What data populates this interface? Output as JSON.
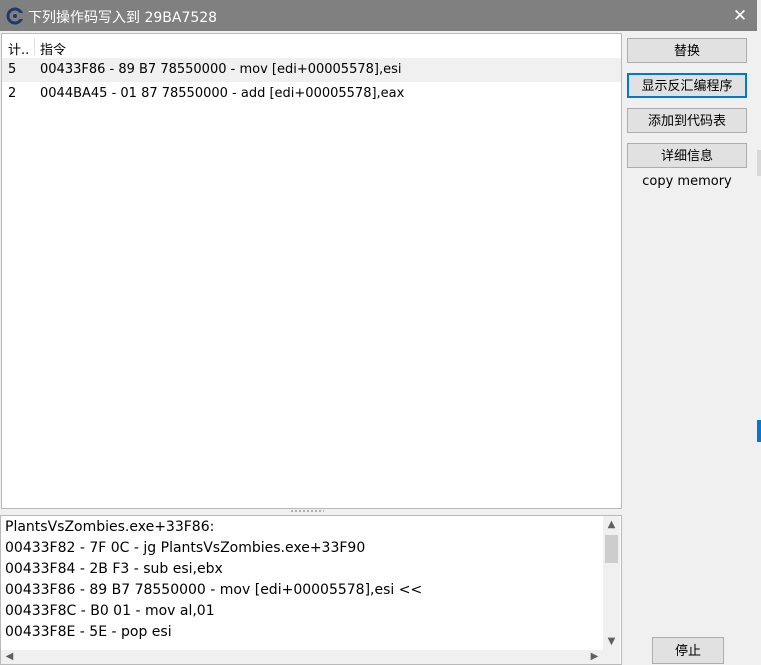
{
  "window": {
    "title": "下列操作码写入到 29BA7528",
    "close_glyph": "✕"
  },
  "list": {
    "columns": {
      "count": "计..",
      "instruction": "指令"
    },
    "rows": [
      {
        "count": "5",
        "instruction": "00433F86 - 89 B7 78550000  - mov [edi+00005578],esi",
        "selected": true
      },
      {
        "count": "2",
        "instruction": "0044BA45 - 01 87 78550000  - add [edi+00005578],eax",
        "selected": false
      }
    ]
  },
  "buttons": {
    "replace": "替换",
    "show_disassembler": "显示反汇编程序",
    "add_to_codelist": "添加到代码表",
    "more_info": "详细信息",
    "copy_memory": "copy memory",
    "stop": "停止"
  },
  "disassembly": {
    "lines": [
      "PlantsVsZombies.exe+33F86:",
      "00433F82 - 7F 0C - jg PlantsVsZombies.exe+33F90",
      "00433F84 - 2B F3  - sub esi,ebx",
      "00433F86 - 89 B7 78550000  - mov [edi+00005578],esi <<",
      "00433F8C - B0 01 - mov al,01",
      "00433F8E - 5E - pop esi"
    ]
  },
  "icons": {
    "app": "cheat-engine-icon",
    "scroll_up": "▲",
    "scroll_down": "▼",
    "scroll_left": "◀",
    "scroll_right": "▶"
  }
}
